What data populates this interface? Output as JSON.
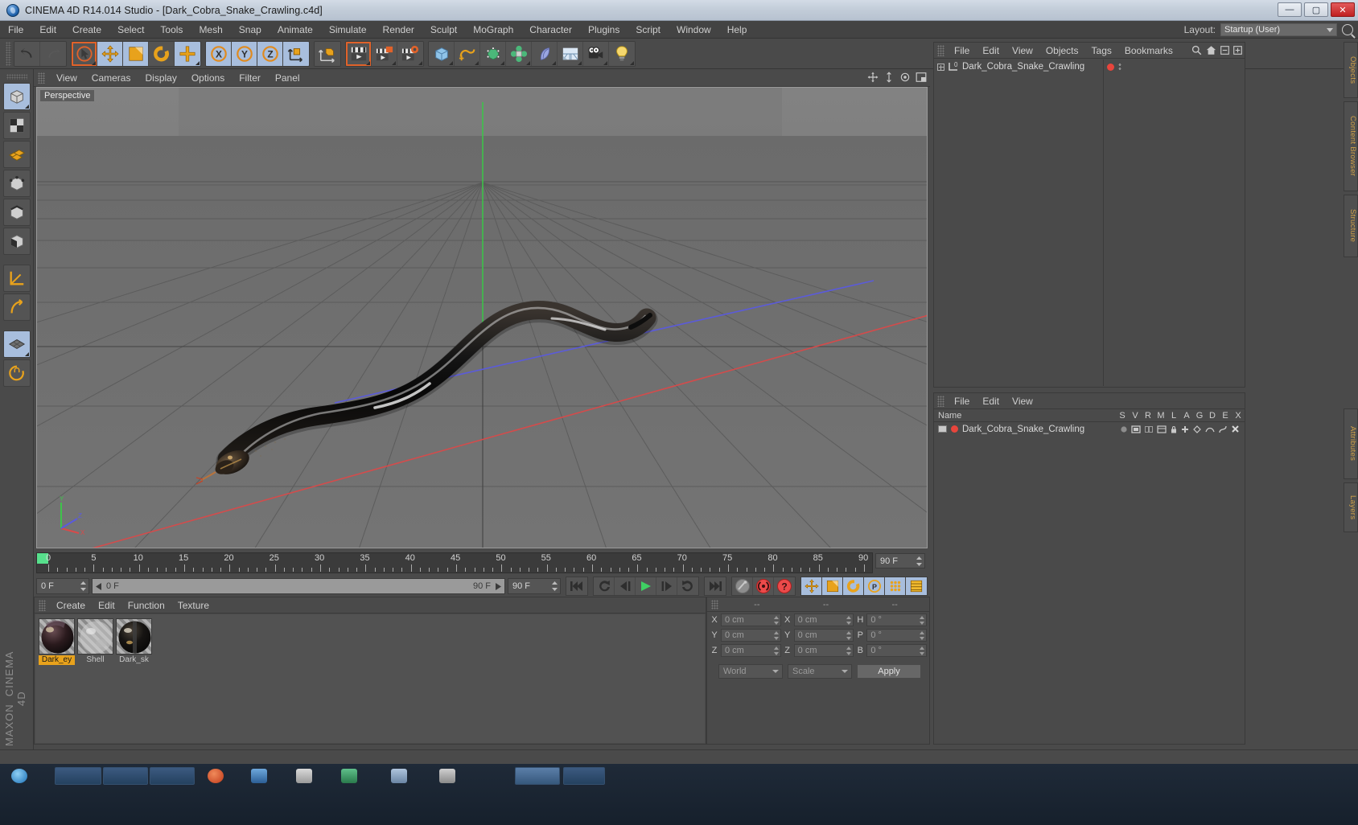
{
  "window": {
    "title": "CINEMA 4D R14.014 Studio - [Dark_Cobra_Snake_Crawling.c4d]",
    "app_icon": "c4d-logo-icon",
    "minimize": "—",
    "maximize": "▢",
    "close": "✕"
  },
  "menubar": {
    "items": [
      "File",
      "Edit",
      "Create",
      "Select",
      "Tools",
      "Mesh",
      "Snap",
      "Animate",
      "Simulate",
      "Render",
      "Sculpt",
      "MoGraph",
      "Character",
      "Plugins",
      "Script",
      "Window",
      "Help"
    ],
    "layout_label": "Layout:",
    "layout_value": "Startup (User)",
    "search_icon": "search-icon"
  },
  "toolbar": {
    "groups": [
      {
        "name": "history",
        "buttons": [
          {
            "icon": "undo-icon",
            "label": "Undo",
            "state": "normal"
          },
          {
            "icon": "redo-icon",
            "label": "Redo",
            "state": "disabled"
          }
        ]
      },
      {
        "name": "tools",
        "buttons": [
          {
            "icon": "live-selection-icon",
            "label": "Live Selection",
            "state": "selected"
          },
          {
            "icon": "move-icon",
            "label": "Move",
            "state": "active"
          },
          {
            "icon": "scale-icon",
            "label": "Scale",
            "state": "active-orange"
          },
          {
            "icon": "rotate-icon",
            "label": "Rotate",
            "state": "normal"
          },
          {
            "icon": "plus-tool-icon",
            "label": "Add",
            "state": "normal"
          }
        ]
      },
      {
        "name": "axis-locks",
        "buttons": [
          {
            "icon": "axis-x-icon",
            "label": "X Axis",
            "state": "active"
          },
          {
            "icon": "axis-y-icon",
            "label": "Y Axis",
            "state": "active"
          },
          {
            "icon": "axis-z-icon",
            "label": "Z Axis",
            "state": "active"
          },
          {
            "icon": "world-coordinate-icon",
            "label": "World / Object Coordinates",
            "state": "active"
          }
        ]
      },
      {
        "name": "render",
        "buttons": [
          {
            "icon": "object-axis-icon",
            "label": "Object Axis",
            "state": "normal"
          }
        ]
      },
      {
        "name": "render2",
        "buttons": [
          {
            "icon": "render-view-icon",
            "label": "Render View",
            "state": "selected"
          },
          {
            "icon": "render-region-icon",
            "label": "Render Region",
            "state": "normal"
          },
          {
            "icon": "render-settings-icon",
            "label": "Render Settings",
            "state": "normal"
          }
        ]
      },
      {
        "name": "primitives",
        "buttons": [
          {
            "icon": "cube-icon",
            "label": "Cube",
            "state": "normal"
          },
          {
            "icon": "spline-icon",
            "label": "Spline",
            "state": "normal"
          },
          {
            "icon": "nurbs-icon",
            "label": "NURBS",
            "state": "normal"
          },
          {
            "icon": "array-icon",
            "label": "Array / Modeling Objects",
            "state": "normal"
          },
          {
            "icon": "deformer-icon",
            "label": "Deformer",
            "state": "normal"
          },
          {
            "icon": "environment-icon",
            "label": "Environment / Floor",
            "state": "normal"
          },
          {
            "icon": "camera-icon",
            "label": "Camera",
            "state": "normal"
          },
          {
            "icon": "light-icon",
            "label": "Light",
            "state": "normal"
          }
        ]
      }
    ]
  },
  "left_toolbar": {
    "buttons": [
      {
        "icon": "model-mode-icon",
        "label": "Model Mode",
        "state": "active"
      },
      {
        "icon": "texture-mode-icon",
        "label": "Texture Mode",
        "state": "normal"
      },
      {
        "icon": "polygon-mode-icon",
        "label": "Polygon Mode",
        "state": "normal"
      },
      {
        "icon": "points-mode-icon",
        "label": "Points Mode",
        "state": "normal"
      },
      {
        "icon": "edges-mode-icon",
        "label": "Edges Mode",
        "state": "normal"
      },
      {
        "icon": "polygons-mode-icon",
        "label": "Polygons Mode",
        "state": "normal"
      },
      {
        "icon": "workplane-icon",
        "label": "Workplane",
        "state": "normal"
      },
      {
        "icon": "enable-axis-icon",
        "label": "Enable Axis Modification",
        "state": "normal"
      },
      {
        "icon": "enable-snap-icon",
        "label": "Enable Snapping",
        "state": "active"
      },
      {
        "icon": "lock-workplane-icon",
        "label": "Lock Workplane",
        "state": "normal"
      }
    ],
    "brand_top": "MAXON",
    "brand_bottom": "CINEMA 4D"
  },
  "viewport": {
    "menu": [
      "View",
      "Cameras",
      "Display",
      "Options",
      "Filter",
      "Panel"
    ],
    "label": "Perspective",
    "nav_icons": [
      "move-view-icon",
      "scale-view-icon",
      "rotate-view-icon",
      "maximize-view-icon"
    ],
    "axis_gizmo": {
      "y": "Y",
      "x": "X",
      "z": "Z"
    },
    "scene_object": "Dark_Cobra_Snake_Crawling"
  },
  "timeline": {
    "start_frame": "0 F",
    "end_frame": "90 F",
    "current_frame": "0 F",
    "preview_start": "0 F",
    "preview_end": "90 F",
    "range_field": "90 F",
    "ticks": [
      0,
      5,
      10,
      15,
      20,
      25,
      30,
      35,
      40,
      45,
      50,
      55,
      60,
      65,
      70,
      75,
      80,
      85,
      90
    ],
    "transport": [
      {
        "icon": "go-to-start-icon",
        "label": "Go To Start"
      },
      {
        "icon": "previous-key-icon",
        "label": "Go To Previous Key"
      },
      {
        "icon": "previous-frame-icon",
        "label": "Go To Previous Frame"
      },
      {
        "icon": "play-icon",
        "label": "Play Forwards",
        "state": "active"
      },
      {
        "icon": "next-frame-icon",
        "label": "Go To Next Frame"
      },
      {
        "icon": "next-key-icon",
        "label": "Go To Next Key"
      },
      {
        "icon": "go-to-end-icon",
        "label": "Go To End"
      }
    ],
    "record_group": [
      {
        "icon": "record-active-objects-icon",
        "label": "Record Active Objects",
        "state": "disabled"
      },
      {
        "icon": "autokeying-icon",
        "label": "Autokeying",
        "state": "red"
      },
      {
        "icon": "keyframe-selection-icon",
        "label": "Keyframe Selection",
        "state": "red"
      }
    ],
    "anim_group": [
      {
        "icon": "position-key-icon",
        "label": "Position",
        "state": "active"
      },
      {
        "icon": "scale-key-icon",
        "label": "Scale",
        "state": "active-orange"
      },
      {
        "icon": "rotation-key-icon",
        "label": "Rotation",
        "state": "active"
      },
      {
        "icon": "parameter-key-icon",
        "label": "Parameter",
        "state": "active"
      },
      {
        "icon": "point-level-anim-icon",
        "label": "Point Level Animation",
        "state": "active"
      },
      {
        "icon": "timeline-toggle-icon",
        "label": "Timeline",
        "state": "active-yellow"
      }
    ]
  },
  "material_manager": {
    "menu": [
      "Create",
      "Edit",
      "Function",
      "Texture"
    ],
    "materials": [
      {
        "name": "Dark_ey",
        "selected": true,
        "swatch": "#2b1c18"
      },
      {
        "name": "Shell",
        "selected": false,
        "swatch": "#c9c9c9"
      },
      {
        "name": "Dark_sk",
        "selected": false,
        "swatch": "#1a1a1a"
      }
    ]
  },
  "coordinates": {
    "headers": [
      "--",
      "--",
      "--"
    ],
    "rows": [
      {
        "axis": "X",
        "position": "0 cm",
        "size_axis": "X",
        "size": "0 cm",
        "rot_axis": "H",
        "rot": "0 °"
      },
      {
        "axis": "Y",
        "position": "0 cm",
        "size_axis": "Y",
        "size": "0 cm",
        "rot_axis": "P",
        "rot": "0 °"
      },
      {
        "axis": "Z",
        "position": "0 cm",
        "size_axis": "Z",
        "size": "0 cm",
        "rot_axis": "B",
        "rot": "0 °"
      }
    ],
    "system": "World",
    "mode": "Scale",
    "apply": "Apply"
  },
  "object_manager": {
    "menu": [
      "File",
      "Edit",
      "View",
      "Objects",
      "Tags",
      "Bookmarks"
    ],
    "header_icons": [
      "search-icon",
      "home-icon",
      "collapse-icon",
      "expand-icon"
    ],
    "objects": [
      {
        "name": "Dark_Cobra_Snake_Crawling",
        "icon": "null-object-icon",
        "layer_color": "#e8453c",
        "level": 0
      }
    ]
  },
  "attribute_manager": {
    "menu": [
      "File",
      "Edit",
      "View"
    ],
    "columns": [
      "Name",
      "S",
      "V",
      "R",
      "M",
      "L",
      "A",
      "G",
      "D",
      "E",
      "X"
    ],
    "rows": [
      {
        "name": "Dark_Cobra_Snake_Crawling",
        "color": "#e8453c"
      }
    ]
  },
  "right_tabs": [
    "Objects",
    "Content Browser",
    "Structure",
    "Attributes",
    "Layers"
  ],
  "colors": {
    "accent_orange": "#e0622a",
    "active_blue": "#a8bedd",
    "panel_bg": "#4a4a4a",
    "viewport_bg": "#6d6d6d",
    "selected_material": "#e8a21c",
    "play_green": "#3fcf63",
    "layer_red": "#e8453c"
  }
}
